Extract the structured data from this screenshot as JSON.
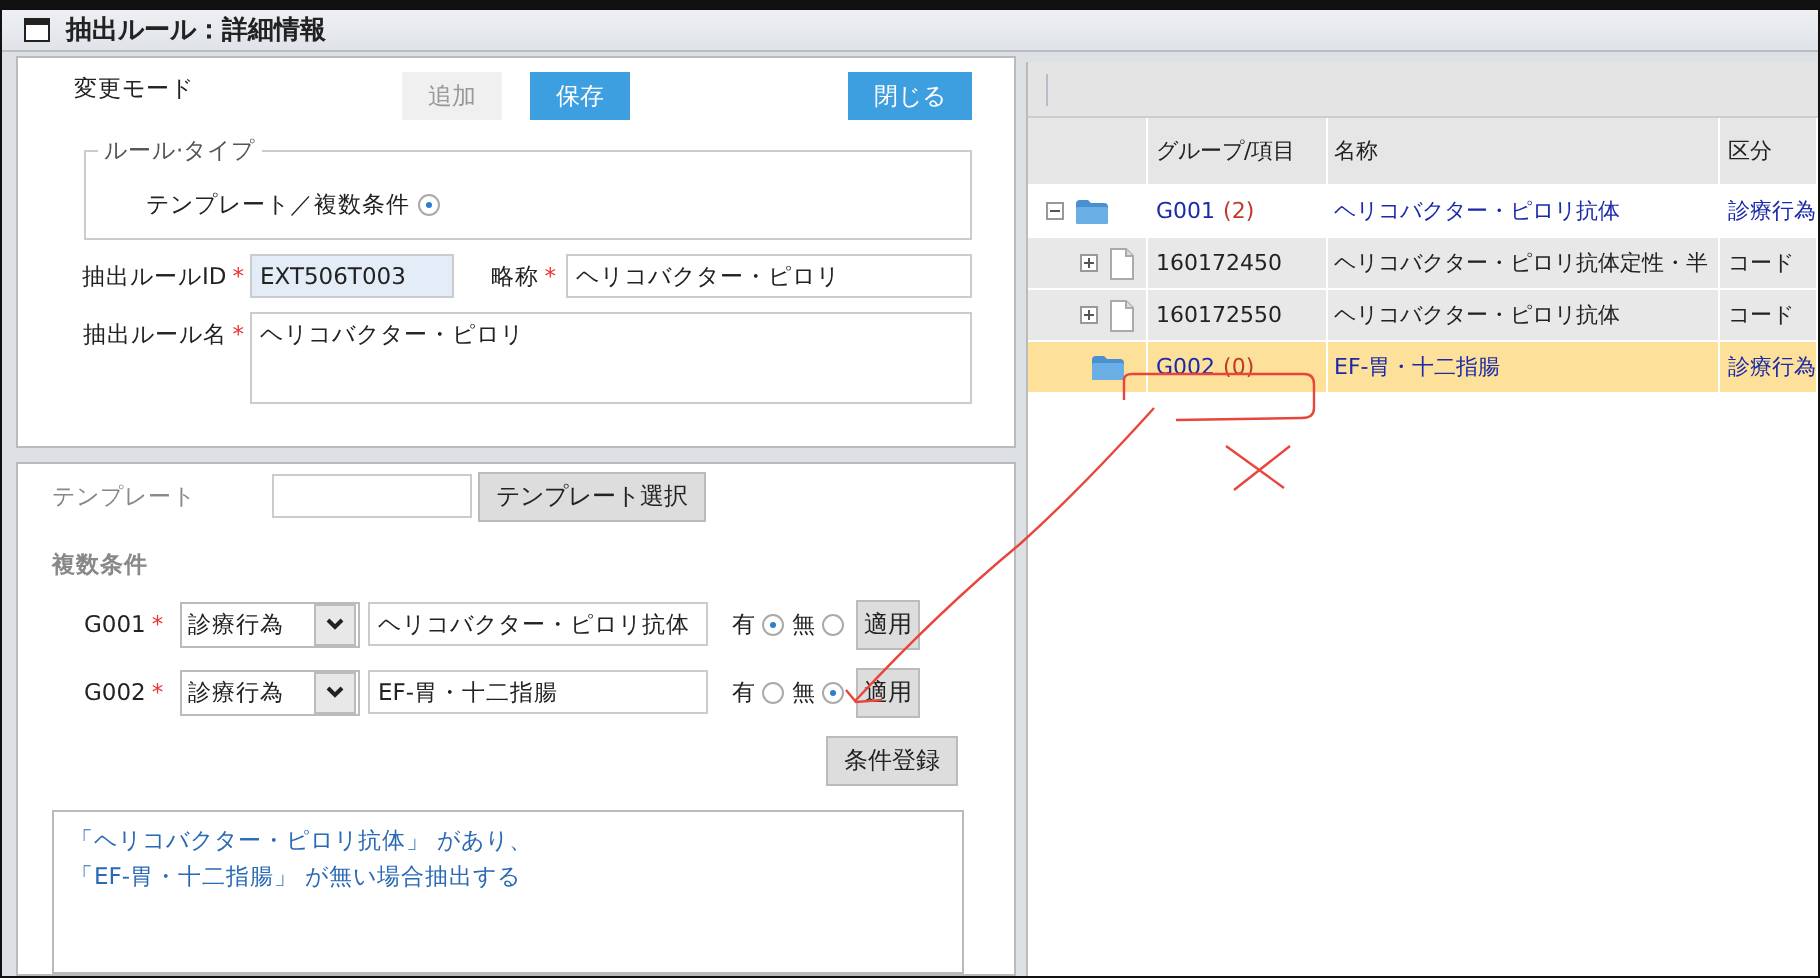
{
  "window": {
    "title": "抽出ルール：詳細情報"
  },
  "form": {
    "mode_label": "変更モード",
    "buttons": [
      {
        "label": "追加",
        "kind": "plain",
        "disabled": true
      },
      {
        "label": "保存",
        "kind": "primary",
        "disabled": false
      },
      {
        "label": "閉じる",
        "kind": "primary",
        "disabled": false
      }
    ],
    "rule_type": {
      "legend": "ルール·タイプ",
      "option": "テンプレート／複数条件",
      "selected": true
    },
    "rule_id": {
      "label": "抽出ルールID",
      "value": "EXT506T003",
      "required_mark": "*"
    },
    "short_name": {
      "label": "略称",
      "value": "ヘリコバクター・ピロリ",
      "required_mark": "*"
    },
    "rule_name": {
      "label": "抽出ルール名",
      "value": "ヘリコバクター・ピロリ",
      "required_mark": "*"
    }
  },
  "template": {
    "label": "テンプレート",
    "select_button": "テンプレート選択"
  },
  "conditions": {
    "title": "複数条件",
    "rows": [
      {
        "group": "G001",
        "required_mark": "*",
        "category": "診療行為",
        "value": "ヘリコバクター・ピロリ抗体",
        "options": [
          {
            "label": "有",
            "selected": true
          },
          {
            "label": "無",
            "selected": false
          }
        ],
        "apply": "適用"
      },
      {
        "group": "G002",
        "required_mark": "*",
        "category": "診療行為",
        "value": "EF-胃・十二指腸",
        "options": [
          {
            "label": "有",
            "selected": false
          },
          {
            "label": "無",
            "selected": true
          }
        ],
        "apply": "適用"
      }
    ],
    "register_button": "条件登録",
    "summary": [
      "「ヘリコバクター・ピロリ抗体」 があり、",
      "「EF-胃・十二指腸」 が無い場合抽出する"
    ]
  },
  "tree": {
    "columns": [
      "グループ/項目",
      "名称",
      "区分"
    ],
    "rows": [
      {
        "kind": "group",
        "code": "G001",
        "count": "(2)",
        "name": "ヘリコバクター・ピロリ抗体",
        "type": "診療行為",
        "expanded": true,
        "selected": false,
        "children": [
          {
            "kind": "item",
            "code": "160172450",
            "name": "ヘリコバクター・ピロリ抗体定性・半",
            "type": "コード",
            "expanded": false,
            "selected": false
          },
          {
            "kind": "item",
            "code": "160172550",
            "name": "ヘリコバクター・ピロリ抗体",
            "type": "コード",
            "expanded": false,
            "selected": false
          }
        ]
      },
      {
        "kind": "group",
        "code": "G002",
        "count": "(0)",
        "name": "EF-胃・十二指腸",
        "type": "診療行為",
        "selected": true
      }
    ]
  }
}
